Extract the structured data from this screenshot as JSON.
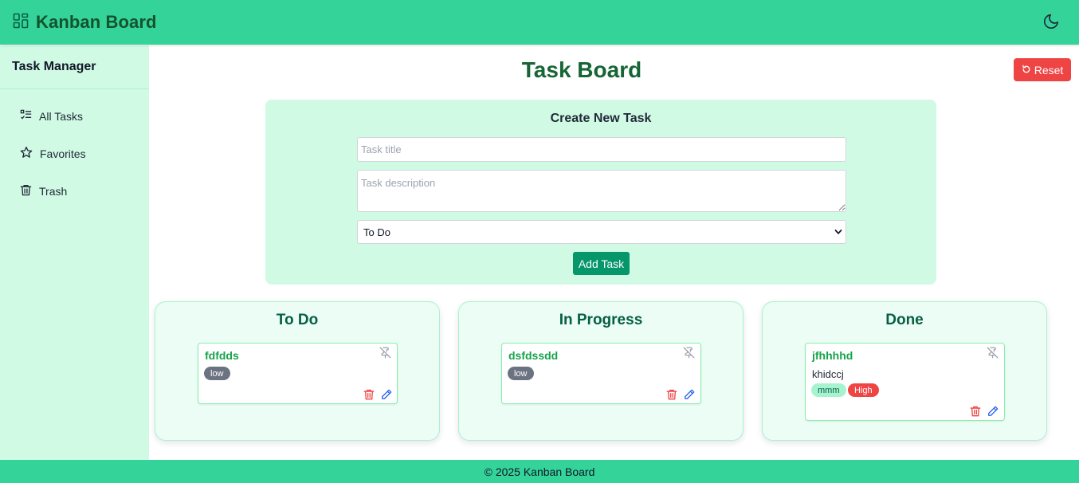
{
  "header": {
    "brand": "Kanban Board",
    "brand_icon": "dashboard-grid-icon",
    "theme_icon": "moon-icon"
  },
  "sidebar": {
    "title": "Task Manager",
    "items": [
      {
        "label": "All Tasks",
        "icon": "task-list-icon"
      },
      {
        "label": "Favorites",
        "icon": "star-icon"
      },
      {
        "label": "Trash",
        "icon": "trash-icon"
      }
    ]
  },
  "main": {
    "title": "Task Board",
    "reset_label": "Reset",
    "reset_icon": "rotate-icon"
  },
  "form": {
    "heading": "Create New Task",
    "title_placeholder": "Task title",
    "title_value": "",
    "desc_placeholder": "Task description",
    "desc_value": "",
    "status_selected": "To Do",
    "add_label": "Add Task"
  },
  "columns": [
    {
      "title": "To Do",
      "tasks": [
        {
          "title": "fdfdds",
          "description": "",
          "tags": [],
          "priority": "low"
        }
      ]
    },
    {
      "title": "In Progress",
      "tasks": [
        {
          "title": "dsfdssdd",
          "description": "",
          "tags": [],
          "priority": "low"
        }
      ]
    },
    {
      "title": "Done",
      "tasks": [
        {
          "title": "jfhhhhd",
          "description": "khidccj",
          "tags": [
            "mmm"
          ],
          "priority": "High"
        }
      ]
    }
  ],
  "footer": {
    "text": "© 2025 Kanban Board"
  },
  "colors": {
    "header_bg": "#34d399",
    "sidebar_bg": "#d1fae5",
    "title_green": "#166534",
    "reset_red": "#ef4444",
    "add_button": "#059669",
    "column_bg": "#ecfdf5",
    "badge_low": "#6b7280",
    "badge_high": "#ef4444",
    "badge_tag": "#a7f3d0"
  }
}
